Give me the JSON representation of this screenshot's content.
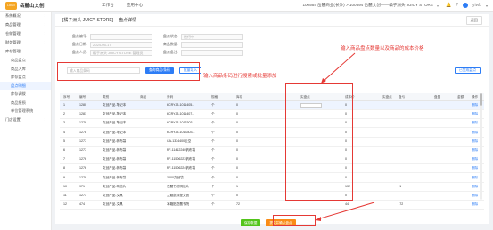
{
  "topbar": {
    "logo_mark": "LOGO",
    "brand": "岳麓山文创",
    "nav": [
      "工作台",
      "应用中心"
    ],
    "store": "100564 岳麓商业(长沙) > 100594 岳麓文创——橘子洲头 JUICY STORE",
    "user": "yiwb"
  },
  "sidebar": {
    "items": [
      {
        "label": "系统概况",
        "type": "item"
      },
      {
        "label": "商品管理",
        "type": "item"
      },
      {
        "label": "仓储管理",
        "type": "item"
      },
      {
        "label": "财务管理",
        "type": "item"
      },
      {
        "label": "库存管理",
        "type": "item"
      },
      {
        "label": "商品盘点",
        "type": "sub"
      },
      {
        "label": "商品入库",
        "type": "sub"
      },
      {
        "label": "库存盘点",
        "type": "sub"
      },
      {
        "label": "盘点明细",
        "type": "sub",
        "active": true
      },
      {
        "label": "库存调拨",
        "type": "sub"
      },
      {
        "label": "商品报损",
        "type": "sub"
      },
      {
        "label": "单位管理系统",
        "type": "sub"
      },
      {
        "label": "门店设置",
        "type": "item"
      }
    ]
  },
  "page": {
    "title": "[橘子洲头 JUICY STORE] -- 盘点详情",
    "back_label": "返回"
  },
  "form": {
    "code_label": "盘点编号:",
    "code_value": "",
    "date_label": "盘点日期:",
    "date_value": "2024-05-17",
    "person_label": "盘点人员:",
    "person_value": "橘子洲头 JUICY STORE 管理员",
    "status_label": "盘点状态:",
    "status_value": "进行中",
    "count_label": "商品数量:",
    "count_value": "",
    "remark_label": "盘点备注:",
    "remark_value": ""
  },
  "search": {
    "placeholder": "输入商品条码",
    "search_btn": "查询商品/条码",
    "import_btn": "批量导入",
    "right_btn": "已完成盘点"
  },
  "annotations": {
    "search_note": "输入商品条码进行搜索或批量添加",
    "qty_note": "输入商品盘点数量以及商品的成本价格"
  },
  "table": {
    "headers": [
      "序号",
      "编号",
      "类别",
      "商品",
      "条码",
      "规格",
      "库存",
      "实盘点",
      "成本价",
      "实盘点",
      "盘亏",
      "盘盈",
      "金额",
      "操作"
    ],
    "rows": [
      {
        "no": "1",
        "code": "1280",
        "cat": "文创产品-笔记本",
        "name": "",
        "barcode": "6CRYJ3-1011405...",
        "spec": "个",
        "stock": "0",
        "count": "",
        "cost": "0",
        "diff": "",
        "op": "删除"
      },
      {
        "no": "2",
        "code": "1281",
        "cat": "文创产品-笔记本",
        "name": "",
        "barcode": "6CRYJ3-1011407...",
        "spec": "个",
        "stock": "0",
        "count": "",
        "cost": "0",
        "diff": "",
        "op": "删除"
      },
      {
        "no": "3",
        "code": "1279",
        "cat": "文创产品-笔记本",
        "name": "",
        "barcode": "6CRYJ3-1013303...",
        "spec": "个",
        "stock": "0",
        "count": "",
        "cost": "0",
        "diff": "",
        "op": "删除"
      },
      {
        "no": "4",
        "code": "1278",
        "cat": "文创产品-笔记本",
        "name": "",
        "barcode": "6CRYJ3-1013303...",
        "spec": "个",
        "stock": "0",
        "count": "",
        "cost": "0",
        "diff": "",
        "op": "删除"
      },
      {
        "no": "5",
        "code": "1277",
        "cat": "文创产品-帆布袋",
        "name": "",
        "barcode": "CA-1334400云空",
        "spec": "个",
        "stock": "0",
        "count": "",
        "cost": "0",
        "diff": "",
        "op": "删除"
      },
      {
        "no": "6",
        "code": "1277",
        "cat": "文创产品-帆布袋",
        "name": "",
        "barcode": "FF-11412240帆布袋",
        "spec": "个",
        "stock": "0",
        "count": "",
        "cost": "0",
        "diff": "",
        "op": "删除"
      },
      {
        "no": "7",
        "code": "1276",
        "cat": "文创产品-帆布袋",
        "name": "",
        "barcode": "FF-11506223帆布袋",
        "spec": "个",
        "stock": "0",
        "count": "",
        "cost": "0",
        "diff": "",
        "op": "删除"
      },
      {
        "no": "8",
        "code": "1276",
        "cat": "文创产品-帆布袋",
        "name": "",
        "barcode": "FF-11506224帆布袋",
        "spec": "个",
        "stock": "0",
        "count": "",
        "cost": "0",
        "diff": "",
        "op": "删除"
      },
      {
        "no": "9",
        "code": "1279",
        "cat": "文创产品-帆布袋",
        "name": "",
        "barcode": "1000文创袋",
        "spec": "个",
        "stock": "0",
        "count": "",
        "cost": "0",
        "diff": "",
        "op": "删除"
      },
      {
        "no": "10",
        "code": "971",
        "cat": "文创产品-明信片",
        "name": "",
        "barcode": "岳麓书院明信片",
        "spec": "个",
        "stock": "1",
        "count": "",
        "cost": "132",
        "diff": "-1",
        "op": "删除"
      },
      {
        "no": "11",
        "code": "1273",
        "cat": "文创产品-文具",
        "name": "",
        "barcode": "主题鼠标垫文创",
        "spec": "个",
        "stock": "0",
        "count": "",
        "cost": "0",
        "diff": "",
        "op": "删除"
      },
      {
        "no": "12",
        "code": "474",
        "cat": "文创产品-文具",
        "name": "",
        "barcode": "冰箱贴岳麓书院",
        "spec": "个",
        "stock": "72",
        "count": "",
        "cost": "44",
        "diff": "-72",
        "op": "删除"
      }
    ]
  },
  "footer": {
    "save_btn": "保存数据",
    "submit_btn": "提交并确认盘点"
  },
  "colors": {
    "accent": "#2d7df6",
    "annotation": "#e53935",
    "save": "#52c41a",
    "submit": "#fa8c16"
  }
}
